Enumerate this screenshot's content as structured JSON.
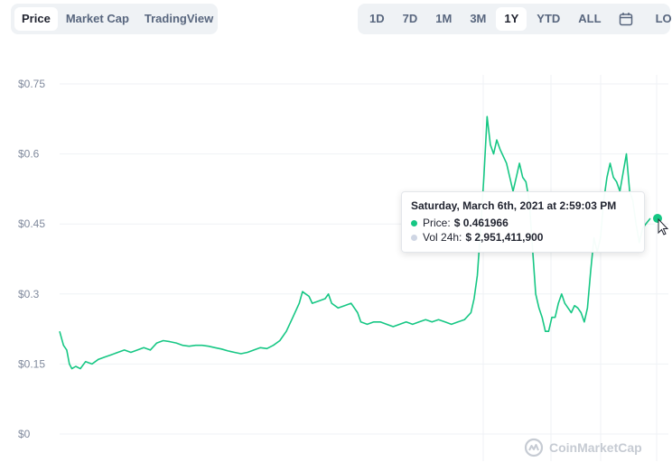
{
  "tabs_left": [
    {
      "label": "Price",
      "active": true
    },
    {
      "label": "Market Cap",
      "active": false
    },
    {
      "label": "TradingView",
      "active": false
    }
  ],
  "tabs_right": [
    {
      "label": "1D",
      "active": false
    },
    {
      "label": "7D",
      "active": false
    },
    {
      "label": "1M",
      "active": false
    },
    {
      "label": "3M",
      "active": false
    },
    {
      "label": "1Y",
      "active": true
    },
    {
      "label": "YTD",
      "active": false
    },
    {
      "label": "ALL",
      "active": false
    }
  ],
  "log_label": "LOG",
  "calendar_icon": "calendar-icon",
  "tooltip": {
    "title": "Saturday, March 6th, 2021 at 2:59:03 PM",
    "price_label": "Price:",
    "price_value": "$ 0.461966",
    "vol_label": "Vol 24h:",
    "vol_value": "$ 2,951,411,900",
    "price_color": "#16c784",
    "vol_color": "#cfd6e4"
  },
  "watermark": "CoinMarketCap",
  "colors": {
    "line": "#16c784",
    "grid": "#eff2f5",
    "axis_text": "#808a9d"
  },
  "chart_data": {
    "type": "line",
    "title": "",
    "xlabel": "",
    "ylabel": "",
    "ylim": [
      0,
      0.75
    ],
    "yticks": [
      0,
      0.15,
      0.3,
      0.45,
      0.6,
      0.75
    ],
    "ytick_labels": [
      "$0",
      "$0.15",
      "$0.3",
      "$0.45",
      "$0.6",
      "$0.75"
    ],
    "grid": true,
    "x_index_range": [
      0,
      1
    ],
    "series": [
      {
        "values": [
          [
            0.0,
            0.22
          ],
          [
            0.006,
            0.19
          ],
          [
            0.011,
            0.18
          ],
          [
            0.015,
            0.15
          ],
          [
            0.019,
            0.14
          ],
          [
            0.025,
            0.145
          ],
          [
            0.032,
            0.14
          ],
          [
            0.04,
            0.155
          ],
          [
            0.05,
            0.15
          ],
          [
            0.06,
            0.16
          ],
          [
            0.07,
            0.165
          ],
          [
            0.08,
            0.17
          ],
          [
            0.09,
            0.175
          ],
          [
            0.1,
            0.18
          ],
          [
            0.11,
            0.175
          ],
          [
            0.12,
            0.18
          ],
          [
            0.13,
            0.185
          ],
          [
            0.14,
            0.18
          ],
          [
            0.15,
            0.195
          ],
          [
            0.16,
            0.2
          ],
          [
            0.17,
            0.198
          ],
          [
            0.18,
            0.195
          ],
          [
            0.19,
            0.19
          ],
          [
            0.2,
            0.188
          ],
          [
            0.21,
            0.19
          ],
          [
            0.22,
            0.19
          ],
          [
            0.23,
            0.188
          ],
          [
            0.24,
            0.185
          ],
          [
            0.25,
            0.182
          ],
          [
            0.26,
            0.178
          ],
          [
            0.27,
            0.175
          ],
          [
            0.28,
            0.172
          ],
          [
            0.29,
            0.175
          ],
          [
            0.3,
            0.18
          ],
          [
            0.31,
            0.185
          ],
          [
            0.32,
            0.183
          ],
          [
            0.33,
            0.19
          ],
          [
            0.34,
            0.2
          ],
          [
            0.35,
            0.22
          ],
          [
            0.36,
            0.25
          ],
          [
            0.37,
            0.28
          ],
          [
            0.375,
            0.305
          ],
          [
            0.38,
            0.3
          ],
          [
            0.385,
            0.295
          ],
          [
            0.39,
            0.28
          ],
          [
            0.4,
            0.285
          ],
          [
            0.41,
            0.29
          ],
          [
            0.415,
            0.3
          ],
          [
            0.42,
            0.28
          ],
          [
            0.43,
            0.27
          ],
          [
            0.44,
            0.275
          ],
          [
            0.45,
            0.28
          ],
          [
            0.46,
            0.26
          ],
          [
            0.465,
            0.24
          ],
          [
            0.475,
            0.235
          ],
          [
            0.485,
            0.24
          ],
          [
            0.495,
            0.24
          ],
          [
            0.505,
            0.235
          ],
          [
            0.515,
            0.23
          ],
          [
            0.525,
            0.235
          ],
          [
            0.535,
            0.24
          ],
          [
            0.545,
            0.235
          ],
          [
            0.555,
            0.24
          ],
          [
            0.565,
            0.245
          ],
          [
            0.575,
            0.24
          ],
          [
            0.585,
            0.245
          ],
          [
            0.595,
            0.24
          ],
          [
            0.605,
            0.235
          ],
          [
            0.615,
            0.24
          ],
          [
            0.625,
            0.245
          ],
          [
            0.635,
            0.26
          ],
          [
            0.64,
            0.29
          ],
          [
            0.645,
            0.34
          ],
          [
            0.65,
            0.44
          ],
          [
            0.655,
            0.55
          ],
          [
            0.66,
            0.68
          ],
          [
            0.665,
            0.62
          ],
          [
            0.67,
            0.6
          ],
          [
            0.675,
            0.63
          ],
          [
            0.68,
            0.61
          ],
          [
            0.69,
            0.58
          ],
          [
            0.695,
            0.55
          ],
          [
            0.7,
            0.52
          ],
          [
            0.705,
            0.55
          ],
          [
            0.71,
            0.58
          ],
          [
            0.715,
            0.55
          ],
          [
            0.72,
            0.54
          ],
          [
            0.725,
            0.5
          ],
          [
            0.73,
            0.4
          ],
          [
            0.735,
            0.3
          ],
          [
            0.74,
            0.27
          ],
          [
            0.745,
            0.25
          ],
          [
            0.75,
            0.22
          ],
          [
            0.755,
            0.22
          ],
          [
            0.76,
            0.25
          ],
          [
            0.765,
            0.25
          ],
          [
            0.77,
            0.28
          ],
          [
            0.775,
            0.3
          ],
          [
            0.78,
            0.28
          ],
          [
            0.785,
            0.27
          ],
          [
            0.79,
            0.26
          ],
          [
            0.795,
            0.275
          ],
          [
            0.8,
            0.27
          ],
          [
            0.805,
            0.26
          ],
          [
            0.81,
            0.24
          ],
          [
            0.815,
            0.27
          ],
          [
            0.82,
            0.35
          ],
          [
            0.825,
            0.42
          ],
          [
            0.83,
            0.39
          ],
          [
            0.835,
            0.42
          ],
          [
            0.84,
            0.5
          ],
          [
            0.845,
            0.55
          ],
          [
            0.85,
            0.58
          ],
          [
            0.855,
            0.55
          ],
          [
            0.86,
            0.54
          ],
          [
            0.865,
            0.52
          ],
          [
            0.87,
            0.56
          ],
          [
            0.875,
            0.6
          ],
          [
            0.88,
            0.52
          ],
          [
            0.885,
            0.5
          ],
          [
            0.89,
            0.45
          ],
          [
            0.895,
            0.41
          ],
          [
            0.9,
            0.44
          ],
          [
            0.905,
            0.45
          ],
          [
            0.912,
            0.462
          ]
        ]
      }
    ],
    "highlight_point_index": 126,
    "legend": "none"
  }
}
